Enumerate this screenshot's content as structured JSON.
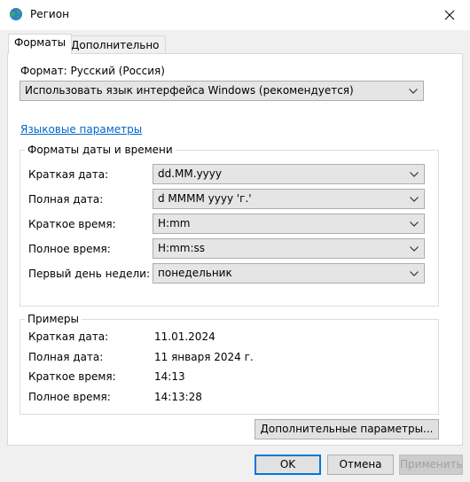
{
  "window": {
    "title": "Регион",
    "app_icon": "globe-icon",
    "close_icon": "close-icon"
  },
  "tabs": [
    {
      "label": "Форматы",
      "active": true
    },
    {
      "label": "Дополнительно",
      "active": false
    }
  ],
  "format": {
    "label": "Формат: Русский (Россия)",
    "selected": "Использовать язык интерфейса Windows (рекомендуется)"
  },
  "language_link": "Языковые параметры",
  "date_time_formats": {
    "title": "Форматы даты и времени",
    "rows": [
      {
        "label": "Краткая дата:",
        "value": "dd.MM.yyyy"
      },
      {
        "label": "Полная дата:",
        "value": "d MMMM yyyy 'г.'"
      },
      {
        "label": "Краткое время:",
        "value": "H:mm"
      },
      {
        "label": "Полное время:",
        "value": "H:mm:ss"
      },
      {
        "label": "Первый день недели:",
        "value": "понедельник"
      }
    ]
  },
  "examples": {
    "title": "Примеры",
    "rows": [
      {
        "label": "Краткая дата:",
        "value": "11.01.2024"
      },
      {
        "label": "Полная дата:",
        "value": "11 января 2024 г."
      },
      {
        "label": "Краткое время:",
        "value": "14:13"
      },
      {
        "label": "Полное время:",
        "value": "14:13:28"
      }
    ]
  },
  "buttons": {
    "additional": "Дополнительные параметры...",
    "ok": "OK",
    "cancel": "Отмена",
    "apply": "Применить"
  },
  "colors": {
    "link": "#0066cc",
    "focus": "#0078d7"
  }
}
